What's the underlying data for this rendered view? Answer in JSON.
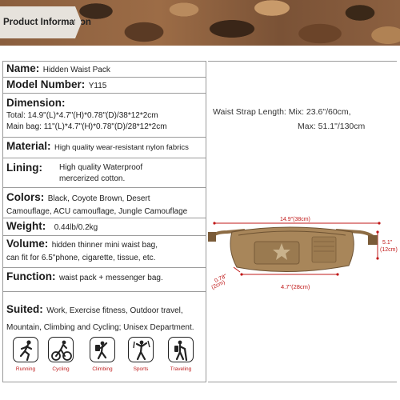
{
  "header": {
    "title": "Product Information"
  },
  "spec": {
    "name": {
      "label": "Name:",
      "value": "Hidden Waist Pack"
    },
    "model": {
      "label": "Model Number:",
      "value": "Y115"
    },
    "dimension": {
      "label": "Dimension:",
      "total": "Total: 14.9\"(L)*4.7\"(H)*0.78\"(D)/38*12*2cm",
      "main_bag": "Main bag: 11\"(L)*4.7\"(H)*0.78\"(D)/28*12*2cm"
    },
    "material": {
      "label": "Material:",
      "value": "High quality wear-resistant nylon fabrics"
    },
    "lining": {
      "label": "Lining:",
      "line1": "High quality Waterproof",
      "line2": "mercerized cotton."
    },
    "colors": {
      "label": "Colors:",
      "line1": "Black, Coyote Brown, Desert",
      "line2": "Camouflage, ACU camouflage, Jungle Camouflage"
    },
    "weight": {
      "label": "Weight:",
      "value": "0.44lb/0.2kg"
    },
    "volume": {
      "label": "Volume:",
      "line1": "hidden thinner mini waist bag,",
      "line2": "can fit for 6.5\"phone, cigarette, tissue, etc."
    },
    "function": {
      "label": "Function:",
      "value": "waist pack + messenger bag."
    },
    "suited": {
      "label": "Suited:",
      "line1": "Work, Exercise fitness, Outdoor travel,",
      "line2": "Mountain, Climbing and Cycling; Unisex Department."
    },
    "activities": [
      {
        "icon": "running-icon",
        "label": "Running"
      },
      {
        "icon": "cycling-icon",
        "label": "Cycling"
      },
      {
        "icon": "climbing-icon",
        "label": "Climbing"
      },
      {
        "icon": "sports-icon",
        "label": "Sports"
      },
      {
        "icon": "traveling-icon",
        "label": "Traveling"
      }
    ]
  },
  "strap": {
    "line1": "Waist Strap Length: Mix: 23.6\"/60cm,",
    "line2": "Max: 51.1\"/130cm"
  },
  "diagram": {
    "width": "14.9\"(38cm)",
    "height_in": "5.1\"",
    "height_cm": "(12cm)",
    "depth_in": "0.78\"",
    "depth_cm": "(2cm)",
    "main_width": "4.7\"(28cm)"
  },
  "colors": {
    "accent_red": "#c01818",
    "bag_brown": "#a8865a"
  }
}
